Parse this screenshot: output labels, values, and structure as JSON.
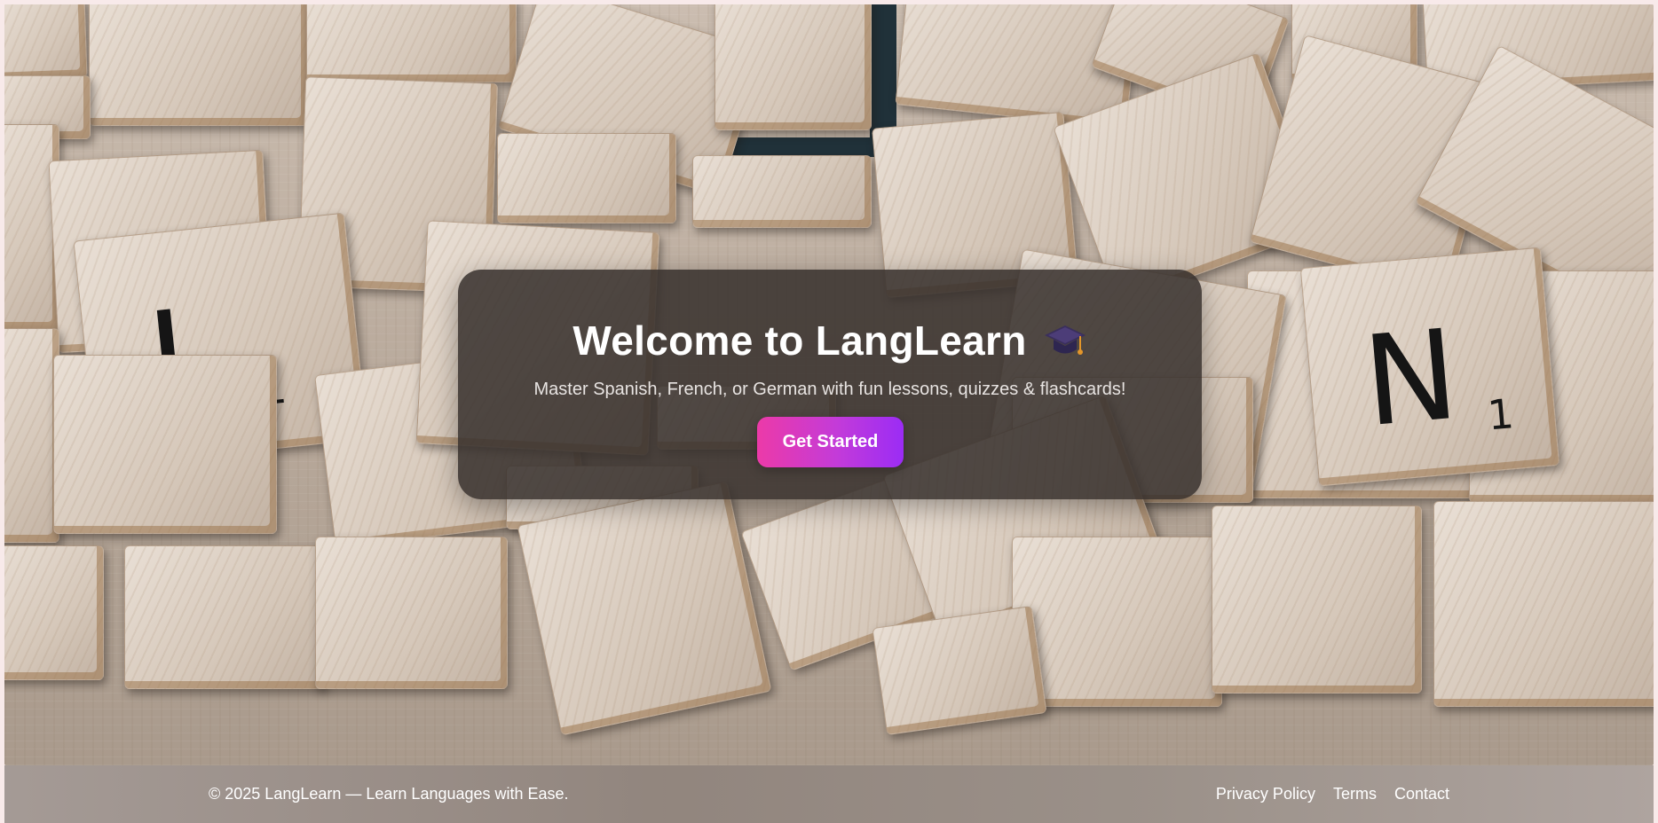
{
  "hero": {
    "title": "Welcome to LangLearn",
    "title_icon": "graduation-cap-icon",
    "subtitle": "Master Spanish, French, or German with fun lessons, quizzes & flashcards!",
    "cta_label": "Get Started",
    "background_tiles": {
      "letter_left": "L",
      "letter_left_sub": "1",
      "letter_right": "N",
      "letter_right_sub": "1"
    }
  },
  "footer": {
    "copyright": "© 2025 LangLearn — Learn Languages with Ease.",
    "links": [
      {
        "label": "Privacy Policy"
      },
      {
        "label": "Terms"
      },
      {
        "label": "Contact"
      }
    ]
  },
  "colors": {
    "cta_gradient_start": "#ec3aa8",
    "cta_gradient_end": "#9b2cf5",
    "card_background": "#37302c",
    "text": "#ffffff"
  }
}
